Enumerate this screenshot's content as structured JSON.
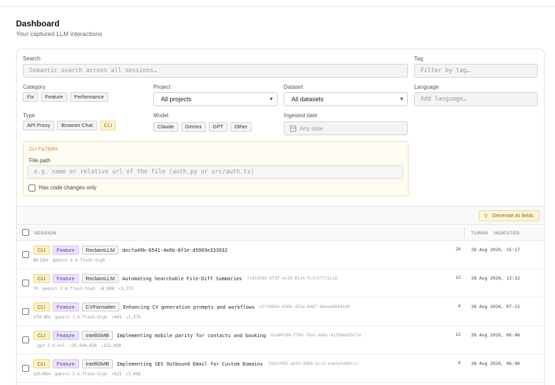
{
  "header": {
    "title": "Dashboard",
    "subtitle": "Your captured LLM interactions"
  },
  "filters": {
    "search": {
      "label": "Search",
      "placeholder": "Semantic search across all sessions…"
    },
    "tag": {
      "label": "Tag",
      "placeholder": "Filter by tag…"
    },
    "category": {
      "label": "Category",
      "options": [
        "Fix",
        "Feature",
        "Performance"
      ]
    },
    "project": {
      "label": "Project",
      "value": "All projects"
    },
    "dataset": {
      "label": "Dataset",
      "value": "All datasets"
    },
    "language": {
      "label": "Language",
      "placeholder": "Add language…"
    },
    "type": {
      "label": "Type",
      "options": [
        "API Proxy",
        "Browser Chat",
        "CLI"
      ],
      "active": "CLI"
    },
    "model": {
      "label": "Model",
      "options": [
        "Claude",
        "Gemini",
        "GPT",
        "Other"
      ]
    },
    "ingested": {
      "label": "Ingested date",
      "placeholder": "Any date"
    },
    "cli": {
      "title": "CLI FILTERS",
      "file_path_label": "File path",
      "file_path_placeholder": "e.g. name or relative url of the file (auth.py or src/auth.ts)",
      "code_changes_label": "Has code changes only"
    }
  },
  "actions": {
    "generate_ai": "Generate AI fields"
  },
  "table": {
    "columns": {
      "session": "SESSION",
      "turns": "TURNS",
      "ingested": "INGESTED"
    },
    "rows": [
      {
        "type": "CLI",
        "category": "Feature",
        "project": "ReclaimLLM",
        "title": "decfa49b-6541-4e6b-8f1e-d5903e333932",
        "id": "",
        "duration": "6h 23m",
        "model": "gemini-3.6-flash-high",
        "tokens_in": "",
        "tokens_out": "",
        "turns": "24",
        "date": "28 Aug 2026, 15:17"
      },
      {
        "type": "CLI",
        "category": "Feature",
        "project": "ReclaimLLM",
        "title": "Automating Searchable File-Diff Summaries",
        "id": "7c81d583-bf3f-4c18-8114-fc7c577c5c18",
        "duration": "7h",
        "model": "gemini-3.6-flash-high",
        "tokens_in": "↑8,098",
        "tokens_out": "↓5,372",
        "turns": "10",
        "date": "28 Aug 2026, 13:32"
      },
      {
        "type": "CLI",
        "category": "Feature",
        "project": "CVFormatter",
        "title": "Enhancing CV generation prompts and workflows",
        "id": "e5f38656-6366-432a-8487-debae8680149",
        "duration": "27m 35s",
        "model": "gemini-3.6-flash-high",
        "tokens_in": "↑401",
        "tokens_out": "↓1,375",
        "turns": "4",
        "date": "28 Aug 2026, 07:15"
      },
      {
        "type": "CLI",
        "category": "Feature",
        "project": "IntelliSMB",
        "title": "Implementing mobile parity for contacts and booking",
        "id": "81a043d0-ff6d-76a2-8abc-81588ebb5c7e",
        "duration": "",
        "model": "gpt-5.6-sol",
        "tokens_in": "↑35,544,820",
        "tokens_out": "↓152,930",
        "turns": "12",
        "date": "28 Aug 2026, 06:46"
      },
      {
        "type": "CLI",
        "category": "Feature",
        "project": "IntelliSMB",
        "title": "Implementing SES Outbound Email for Custom Domains",
        "id": "7a83c092-a633-4d66-bcc5-eae5e5dd6ccc",
        "duration": "11h 49m",
        "model": "gemini-3.6-flash-high",
        "tokens_in": "↑521",
        "tokens_out": "↓3,056",
        "turns": "6",
        "date": "28 Aug 2026, 06:46"
      }
    ]
  }
}
